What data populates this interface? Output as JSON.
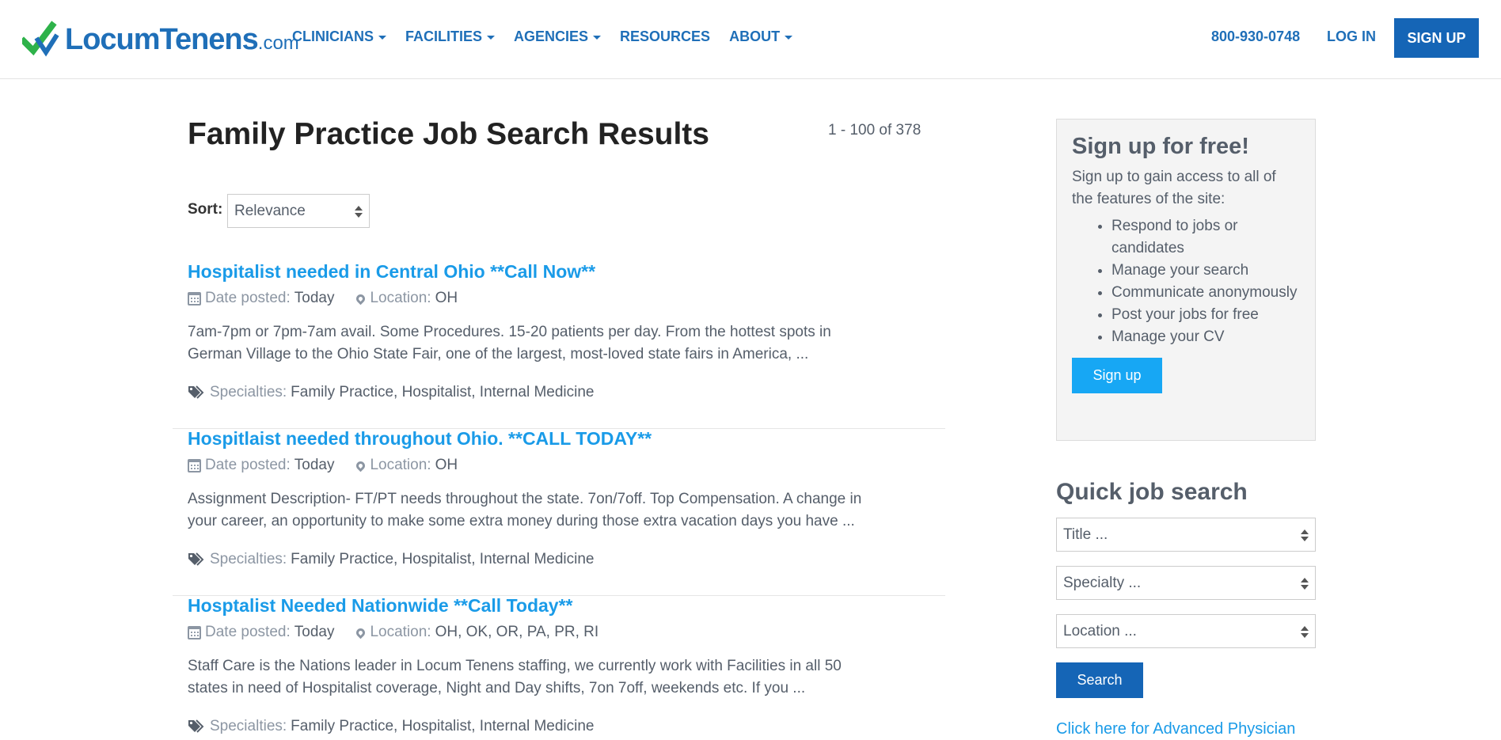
{
  "header": {
    "logo_text": "LocumTenens",
    "logo_suffix": ".com",
    "nav": [
      {
        "label": "CLINICIANS",
        "dropdown": true
      },
      {
        "label": "FACILITIES",
        "dropdown": true
      },
      {
        "label": "AGENCIES",
        "dropdown": true
      },
      {
        "label": "RESOURCES",
        "dropdown": false
      },
      {
        "label": "ABOUT",
        "dropdown": true
      }
    ],
    "phone": "800-930-0748",
    "login": "LOG IN",
    "signup": "SIGN UP"
  },
  "results": {
    "title": "Family Practice Job Search Results",
    "count": "1 - 100 of 378",
    "sort_label": "Sort:",
    "sort_value": "Relevance"
  },
  "labels": {
    "date_posted": "Date posted:",
    "location": "Location:",
    "specialties": "Specialties:"
  },
  "jobs": [
    {
      "title": "Hospitalist needed in Central Ohio **Call Now**",
      "date": "Today",
      "location": "OH",
      "desc_line1": "7am-7pm or 7pm-7am avail. Some Procedures. 15-20 patients per day. From the hottest spots in",
      "desc_line2": "German Village to the Ohio State Fair, one of the largest, most-loved state fairs in America, ...",
      "specialties": "Family Practice, Hospitalist, Internal Medicine"
    },
    {
      "title": "Hospitlaist needed throughout Ohio. **CALL TODAY**",
      "date": "Today",
      "location": "OH",
      "desc_line1": "Assignment Description- FT/PT needs throughout the state. 7on/7off. Top Compensation. A change in",
      "desc_line2": "your career, an opportunity to make some extra money during those extra vacation days you have ...",
      "specialties": "Family Practice, Hospitalist, Internal Medicine"
    },
    {
      "title": "Hosptalist Needed Nationwide **Call Today**",
      "date": "Today",
      "location": "OH, OK, OR, PA, PR, RI",
      "desc_line1": "Staff Care is the Nations leader in Locum Tenens staffing, we currently work with Facilities in all 50",
      "desc_line2": "states in need of Hospitalist coverage, Night and Day shifts, 7on 7off, weekends etc. If you ...",
      "specialties": "Family Practice, Hospitalist, Internal Medicine"
    }
  ],
  "sidebar": {
    "signup_title": "Sign up for free!",
    "signup_intro": "Sign up to gain access to all of the features of the site:",
    "benefits": [
      "Respond to jobs or candidates",
      "Manage your search",
      "Communicate anonymously",
      "Post your jobs for free",
      "Manage your CV"
    ],
    "signup_button": "Sign up",
    "quick_search_title": "Quick job search",
    "title_placeholder": "Title ...",
    "specialty_placeholder": "Specialty ...",
    "location_placeholder": "Location ...",
    "search_button": "Search",
    "advanced_link": "Click here for Advanced Physician"
  },
  "colors": {
    "brand_blue": "#1565b6",
    "link_blue": "#1a9be8",
    "logo_green": "#2eb24a"
  }
}
